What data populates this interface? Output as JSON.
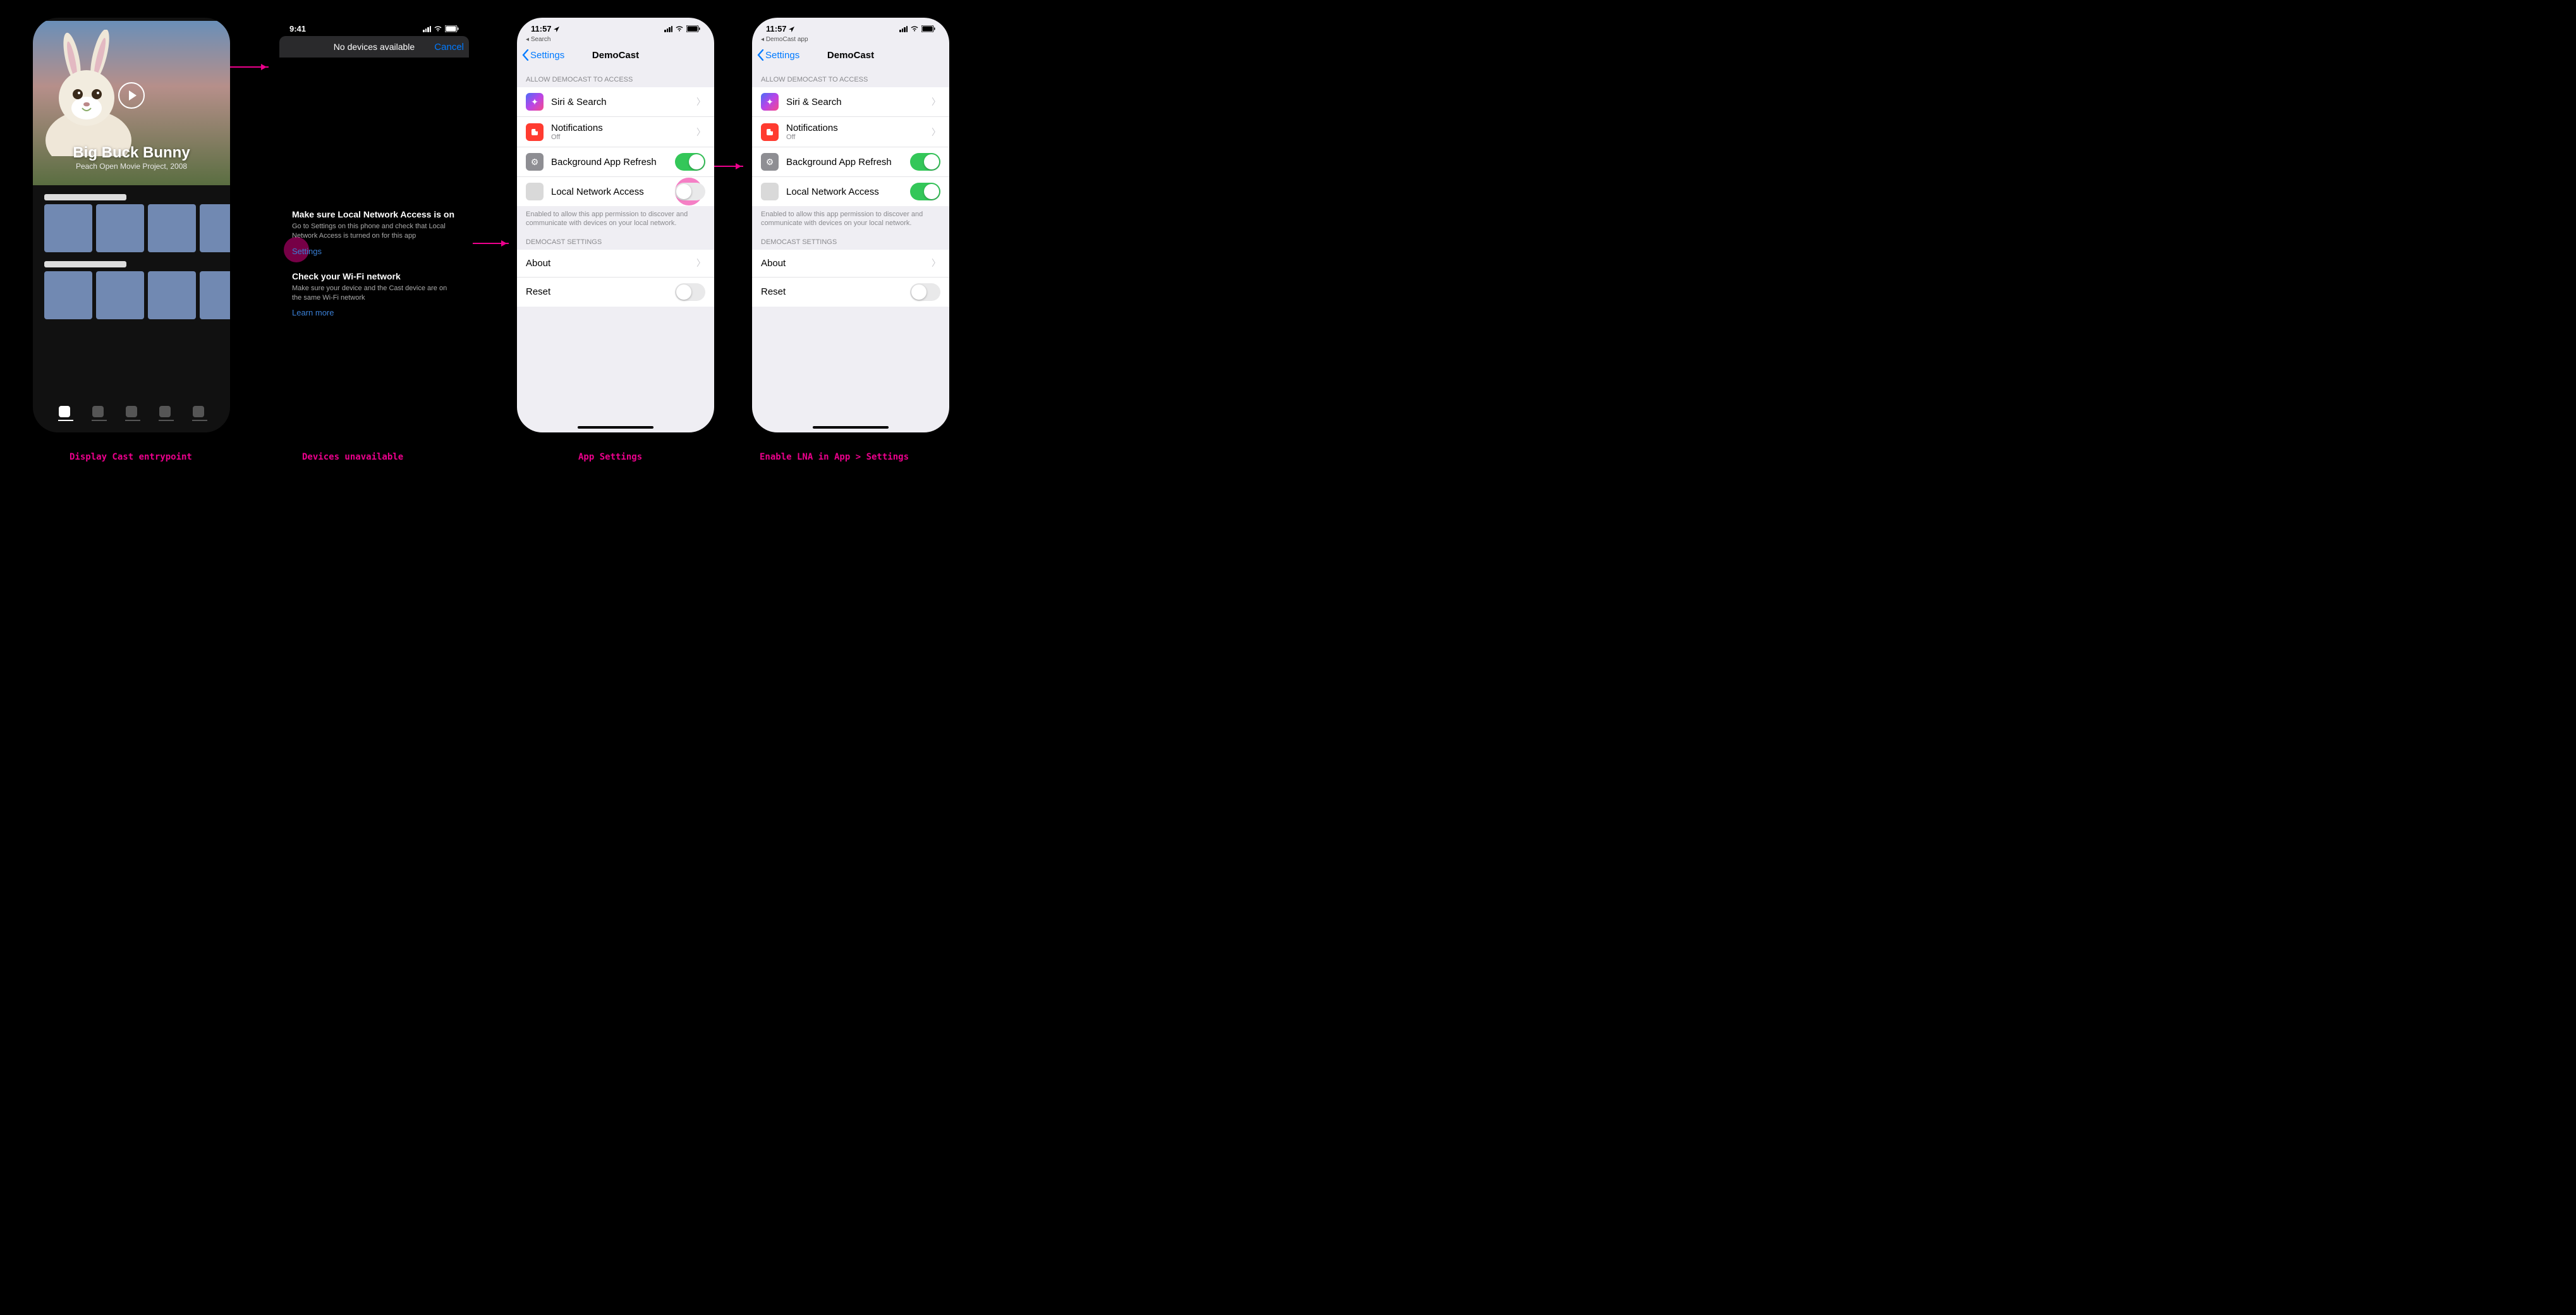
{
  "captions": {
    "c1": "Display Cast entrypoint",
    "c2": "Devices unavailable",
    "c3": "App Settings",
    "c4": "Enable LNA in App > Settings"
  },
  "statusTime1": "9:41",
  "statusTime2": "11:57",
  "breadcrumb1": "Search",
  "breadcrumb2": "DemoCast app",
  "castApp": {
    "name": "DemoCast",
    "heroTitle": "Big Buck Bunny",
    "heroSub": "Peach Open Movie Project, 2008"
  },
  "noDevices": {
    "title": "No devices available",
    "cancel": "Cancel",
    "h1": "Make sure Local Network Access is on",
    "p1": "Go to Settings on this phone and check that Local Network Access is turned on for this app",
    "settings": "Settings",
    "h2": "Check your Wi-Fi network",
    "p2": "Make sure your device and the Cast device are on the same Wi-Fi network",
    "learn": "Learn more"
  },
  "settings": {
    "back": "Settings",
    "title": "DemoCast",
    "section1": "Allow DemoCast to Access",
    "siri": "Siri & Search",
    "notif": "Notifications",
    "notifSub": "Off",
    "bgRefresh": "Background App Refresh",
    "lna": "Local Network Access",
    "lnaNote": "Enabled to allow this app permission to discover and communicate with devices on your local network.",
    "section2": "DemoCast Settings",
    "about": "About",
    "reset": "Reset"
  }
}
